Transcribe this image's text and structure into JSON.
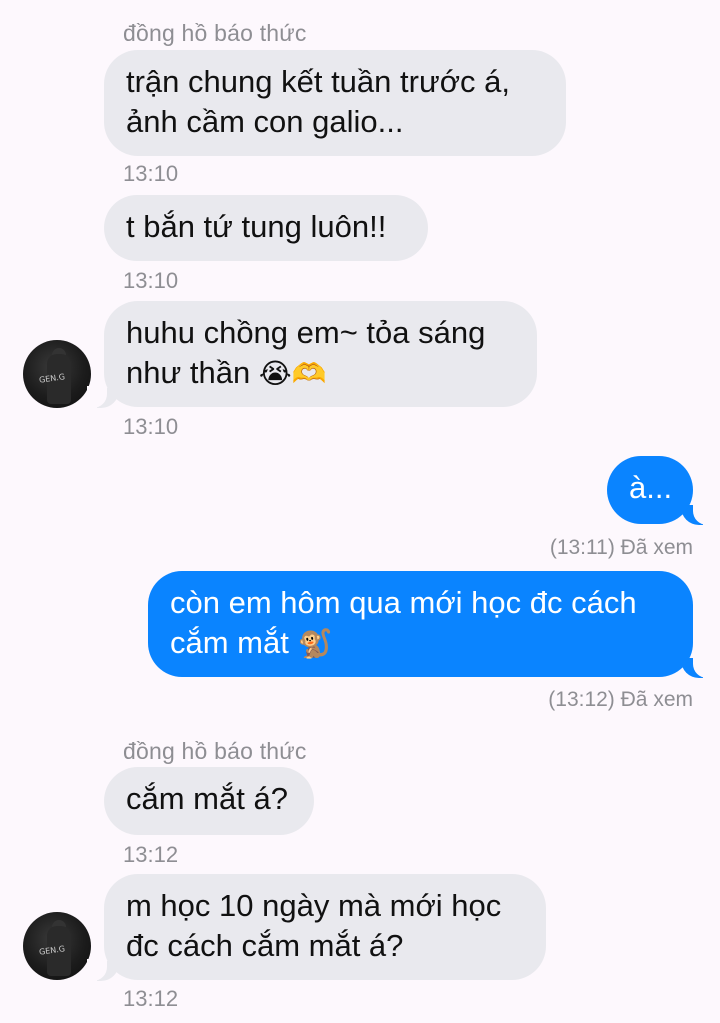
{
  "chat": {
    "sender_name_1": "đồng hồ báo thức",
    "sender_name_2": "đồng hồ báo thức",
    "messages": [
      {
        "text": "trận chung kết tuần trước á, ảnh cầm con galio...",
        "time": "13:10"
      },
      {
        "text": "t bắn tứ tung luôn!!",
        "time": "13:10"
      },
      {
        "text": "huhu chồng em~ tỏa sáng như thần",
        "emoji": "😭🫶",
        "time": "13:10"
      },
      {
        "text": "à...",
        "status": "(13:11) Đã xem"
      },
      {
        "text": "còn em hôm qua mới học đc cách cắm mắt",
        "emoji": "🐒",
        "status": "(13:12) Đã xem"
      },
      {
        "text": "cắm mắt á?",
        "time": "13:12"
      },
      {
        "text": "m học 10 ngày mà mới học đc cách cắm mắt á?",
        "time": "13:12"
      }
    ],
    "avatar_text": "GEN.G"
  },
  "colors": {
    "background": "#fdf8fd",
    "incoming_bubble": "#e9e9ee",
    "outgoing_bubble": "#0a84ff",
    "meta_text": "#8e8e93"
  }
}
